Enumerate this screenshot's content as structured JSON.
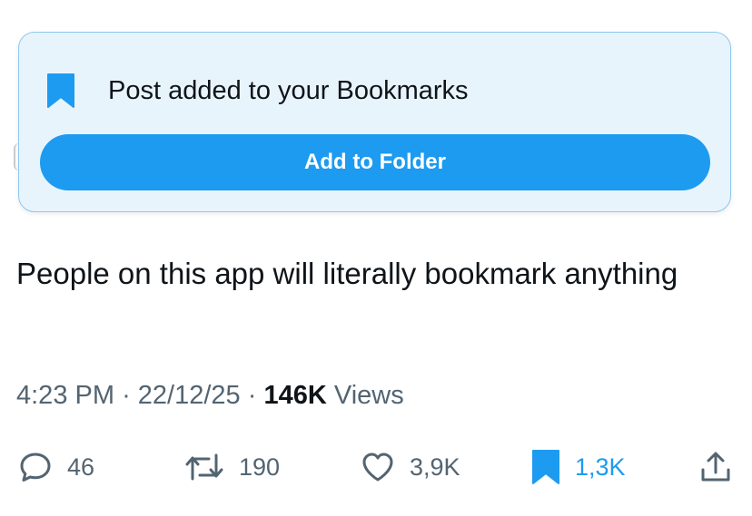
{
  "toast": {
    "message": "Post added to your Bookmarks",
    "button_label": "Add to Folder",
    "icon": "bookmark-filled-icon",
    "accent": "#1d9bf0"
  },
  "post": {
    "text": "People on this app will literally bookmark anything",
    "time": "4:23 PM",
    "separator": "·",
    "date": "22/12/25",
    "views_count": "146K",
    "views_label": "Views"
  },
  "actions": {
    "reply": {
      "icon": "reply-icon",
      "count": "46"
    },
    "repost": {
      "icon": "repost-icon",
      "count": "190"
    },
    "like": {
      "icon": "heart-icon",
      "count": "3,9K"
    },
    "bookmark": {
      "icon": "bookmark-filled-icon",
      "count": "1,3K",
      "active": true,
      "color": "#1d9bf0"
    },
    "share": {
      "icon": "share-icon"
    }
  }
}
